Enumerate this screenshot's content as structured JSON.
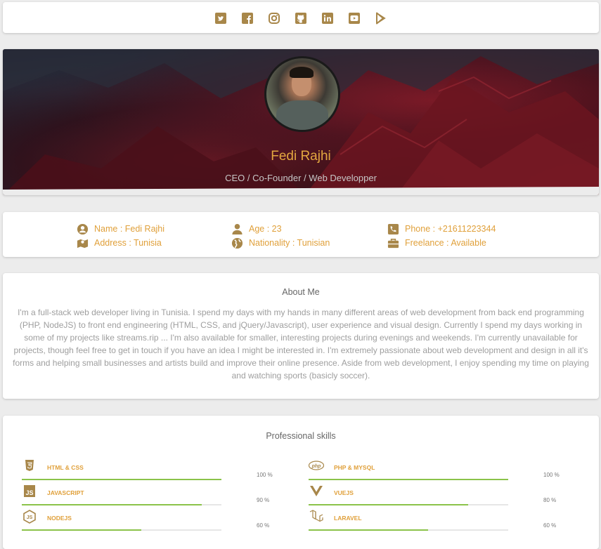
{
  "social": [
    {
      "name": "twitter-icon",
      "label": "twitter"
    },
    {
      "name": "facebook-icon",
      "label": "facebook"
    },
    {
      "name": "instagram-icon",
      "label": "instagram"
    },
    {
      "name": "github-icon",
      "label": "github"
    },
    {
      "name": "linkedin-icon",
      "label": "linkedin"
    },
    {
      "name": "youtube-icon",
      "label": "youtube"
    },
    {
      "name": "google-play-icon",
      "label": "google-play"
    }
  ],
  "colors": {
    "accent": "#e0a03a",
    "icon": "#a8874a",
    "bar": "#8bc34a",
    "muted": "#9e9e9e"
  },
  "hero": {
    "name": "Fedi Rajhi",
    "title": "CEO / Co-Founder / Web Developper"
  },
  "info": {
    "name": "Name : Fedi Rajhi",
    "address": "Address : Tunisia",
    "age": "Age : 23",
    "nationality": "Nationality : Tunisian",
    "phone": "Phone : +21611223344",
    "freelance": "Freelance : Available"
  },
  "about": {
    "title": "About Me",
    "text": "I'm a full-stack web developer living in Tunisia. I spend my days with my hands in many different areas of web development from back end programming (PHP, NodeJS) to front end engineering (HTML, CSS, and jQuery/Javascript), user experience and visual design. Currently I spend my days working in some of my projects like streams.rip ... I'm also available for smaller, interesting projects during evenings and weekends. I'm currently unavailable for projects, though feel free to get in touch if you have an idea I might be interested in. I'm extremely passionate about web development and design in all it's forms and helping small businesses and artists build and improve their online presence. Aside from web development, I enjoy spending my time on playing and watching sports (basicly soccer)."
  },
  "skills": {
    "title": "Professional skills",
    "left": [
      {
        "label": "HTML & CSS",
        "percent": "100 %",
        "level": 100,
        "icon": "html5-icon"
      },
      {
        "label": "JAVASCRIPT",
        "percent": "90 %",
        "level": 90,
        "icon": "js-icon"
      },
      {
        "label": "NODEJS",
        "percent": "60 %",
        "level": 60,
        "icon": "nodejs-icon"
      }
    ],
    "right": [
      {
        "label": "PHP & MYSQL",
        "percent": "100 %",
        "level": 100,
        "icon": "php-icon"
      },
      {
        "label": "VUEJS",
        "percent": "80 %",
        "level": 80,
        "icon": "vuejs-icon"
      },
      {
        "label": "LARAVEL",
        "percent": "60 %",
        "level": 60,
        "icon": "laravel-icon"
      }
    ]
  }
}
